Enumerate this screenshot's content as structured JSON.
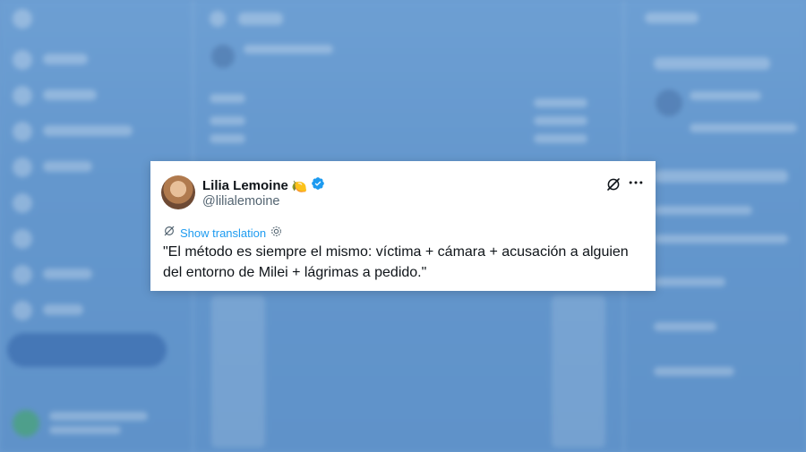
{
  "tweet": {
    "author_name": "Lilia Lemoine",
    "author_emoji": "🍋",
    "handle": "@lilialemoine",
    "verified": true,
    "show_translation_label": "Show translation",
    "text": "\"El método es siempre el mismo: víctima + cámara + acusación a alguien del entorno de Milei + lágrimas a pedido.\""
  },
  "icons": {
    "verified": "verified-badge-icon",
    "grok": "grok-icon",
    "more": "more-options-icon",
    "translate": "translate-icon",
    "settings": "gear-icon"
  },
  "colors": {
    "background_overlay": "#6b9bd0",
    "link": "#1d9bf0",
    "verified": "#1d9bf0",
    "text_primary": "#0f1419",
    "text_secondary": "#536471"
  }
}
